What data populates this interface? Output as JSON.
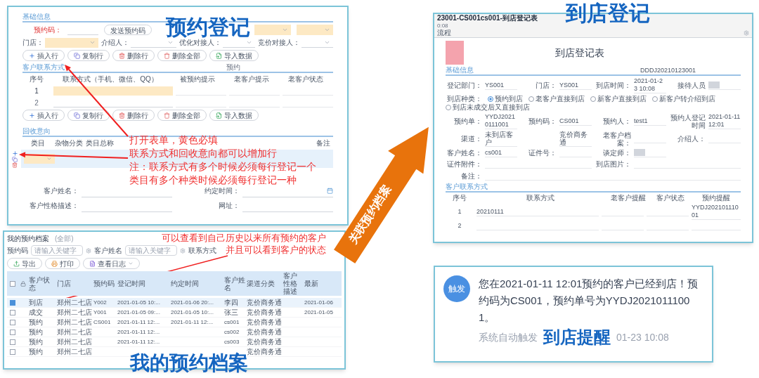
{
  "registration": {
    "title": "预约登记",
    "basic_section": "基础信息",
    "code_field": {
      "label": "预约码：",
      "required": true,
      "button": "发送预约码"
    },
    "fields": [
      {
        "label": "门店：",
        "required": true
      },
      {
        "label": "介绍人：",
        "required": false
      },
      {
        "label": "优化对接人：",
        "required": false
      },
      {
        "label": "竞价对接人：",
        "required": false
      }
    ],
    "toolbar": [
      {
        "label": "插入行",
        "kind": "insert"
      },
      {
        "label": "复制行",
        "kind": "copy"
      },
      {
        "label": "删除行",
        "kind": "delete"
      },
      {
        "label": "删除全部",
        "kind": "clear"
      },
      {
        "label": "导入数据",
        "kind": "import"
      }
    ],
    "contact": {
      "section": "客户联系方式",
      "right_label": "预约",
      "columns": [
        "序号",
        "联系方式（手机、微信、QQ）",
        "被预约提示",
        "老客户提示",
        "老客户状态"
      ],
      "rows": [
        {
          "index": "1",
          "required": true
        },
        {
          "index": "2",
          "required": false
        }
      ]
    },
    "toolbar_2": [
      {
        "label": "插入行",
        "kind": "insert"
      },
      {
        "label": "复制行",
        "kind": "copy"
      },
      {
        "label": "删除行",
        "kind": "delete"
      },
      {
        "label": "删除全部",
        "kind": "clear"
      },
      {
        "label": "导入数据",
        "kind": "import"
      }
    ],
    "recycle": {
      "section": "回收意向",
      "columns": [
        "类目",
        "杂物分类",
        "类目总称"
      ],
      "last_column": "备注"
    },
    "bottom_fields": [
      {
        "label": "客户姓名："
      },
      {
        "label": "约定时间：",
        "kind": "date"
      },
      {
        "label": "客户性格描述："
      },
      {
        "label": "网址："
      }
    ],
    "annotation": [
      "打开表单，黄色必填",
      "联系方式和回收意向都可以增加行",
      "注：联系方式有多个时候必须每行登记一个",
      "类目有多个种类时候必须每行登记一种"
    ]
  },
  "archive": {
    "title": "我的预约档案",
    "tag": "(全部)",
    "filters": [
      {
        "label": "预约码",
        "placeholder": "请输入关键字"
      },
      {
        "label": "客户姓名",
        "placeholder": "请输入关键字"
      }
    ],
    "third_filter": "联系方式",
    "toolbar": [
      {
        "label": "导出",
        "kind": "export"
      },
      {
        "label": "打印",
        "kind": "print"
      },
      {
        "label": "查看日志",
        "kind": "log"
      }
    ],
    "all_selected": false,
    "columns": [
      "客户状态",
      "门店",
      "预约码",
      "登记时间",
      "约定时间",
      "客户姓名",
      "渠道分类",
      "客户性格描述",
      "最新"
    ],
    "rows": [
      {
        "selected": true,
        "cells": [
          "到店",
          "郑州二七店",
          "Y002",
          "2021-01-05 10:...",
          "2021-01-06 20:...",
          "李四",
          "竞价商务通",
          "",
          "2021-01-06"
        ]
      },
      {
        "selected": false,
        "cells": [
          "成交",
          "郑州二七店",
          "Y001",
          "2021-01-05 09:...",
          "2021-01-05 10:...",
          "张三",
          "竞价商务通",
          "",
          "2021-01-05"
        ]
      },
      {
        "selected": false,
        "cells": [
          "预约",
          "郑州二七店",
          "CS001",
          "2021-01-11 12:...",
          "2021-01-11 12:...",
          "cs001",
          "竞价商务通",
          "",
          ""
        ]
      },
      {
        "selected": false,
        "cells": [
          "预约",
          "郑州二七店",
          "",
          "2021-01-11 12:...",
          "",
          "cs002",
          "竞价商务通",
          "",
          ""
        ]
      },
      {
        "selected": false,
        "cells": [
          "预约",
          "郑州二七店",
          "",
          "2021-01-11 12:...",
          "",
          "cs003",
          "竞价商务通",
          "",
          ""
        ]
      },
      {
        "selected": false,
        "cells": [
          "预约",
          "郑州二七店",
          "",
          "",
          "",
          "",
          "竞价商务通",
          "",
          ""
        ]
      }
    ],
    "overlay_title": "我的预约档案",
    "annotation": [
      "可以查看到自己历史以来所有预约的客户",
      "并且可以看到客户的状态"
    ]
  },
  "link_arrow": {
    "label": "关联预约档案"
  },
  "arrival": {
    "window_title": "23001-CS001cs001-到店登记表",
    "subtitle": "0:08",
    "tab": "流程",
    "overlay_title": "到店登记",
    "form_title": "到店登记表",
    "section": "基础信息",
    "doc_no": "DDDJ20210123001",
    "row_1": [
      {
        "label": "登记部门：",
        "value": "YS001"
      },
      {
        "label": "门店：",
        "value": "YS001"
      },
      {
        "label": "到店时间：",
        "value": "2021-01-23 10:08"
      },
      {
        "label": "接待人员",
        "masked": true
      }
    ],
    "visit_type": {
      "label": "到店种类：",
      "options": [
        {
          "label": "预约到店",
          "selected": true
        },
        {
          "label": "老客户直接到店",
          "selected": false
        },
        {
          "label": "新客户直接到店",
          "selected": false
        },
        {
          "label": "新客户转介绍到店",
          "selected": false
        },
        {
          "label": "到店未成交后又直接到店",
          "selected": false
        }
      ]
    },
    "row_2": [
      {
        "label": "预约单：",
        "value": "YYDJ20210111001"
      },
      {
        "label": "预约码：",
        "value": "CS001"
      },
      {
        "label": "预约人：",
        "value": "test1"
      },
      {
        "label": "预约人登记时间",
        "value": "2021-01-11 12:01"
      }
    ],
    "row_3": [
      {
        "label": "渠道：",
        "value": "未到店客户"
      },
      {
        "value": "竞价商务通"
      },
      {
        "label": "老客户档案："
      },
      {
        "label": "介绍人："
      }
    ],
    "row_4": [
      {
        "label": "客户姓名：",
        "value": "cs001"
      },
      {
        "label": "证件号："
      },
      {
        "label": "谈定师：",
        "masked": true
      }
    ],
    "wide_fields": [
      {
        "label": "证件附件："
      },
      {
        "label": "到店图片："
      }
    ],
    "note_label": "备注：",
    "contact_section": "客户联系方式",
    "contact_columns": [
      "序号",
      "联系方式",
      "老客户提醒",
      "客户状态",
      "预约提醒"
    ],
    "contact_rows": [
      {
        "index": "1",
        "contact": "20210111",
        "reminder": "YYDJ20210111001"
      },
      {
        "index": "2"
      }
    ]
  },
  "notification": {
    "avatar": "触发",
    "message": "您在2021-01-11 12:01预约的客户已经到店！预约码为CS001，预约单号为YYDJ20210111001。",
    "source": "系统自动触发",
    "overlay_title": "到店提醒",
    "time": "01-23 10:08"
  }
}
